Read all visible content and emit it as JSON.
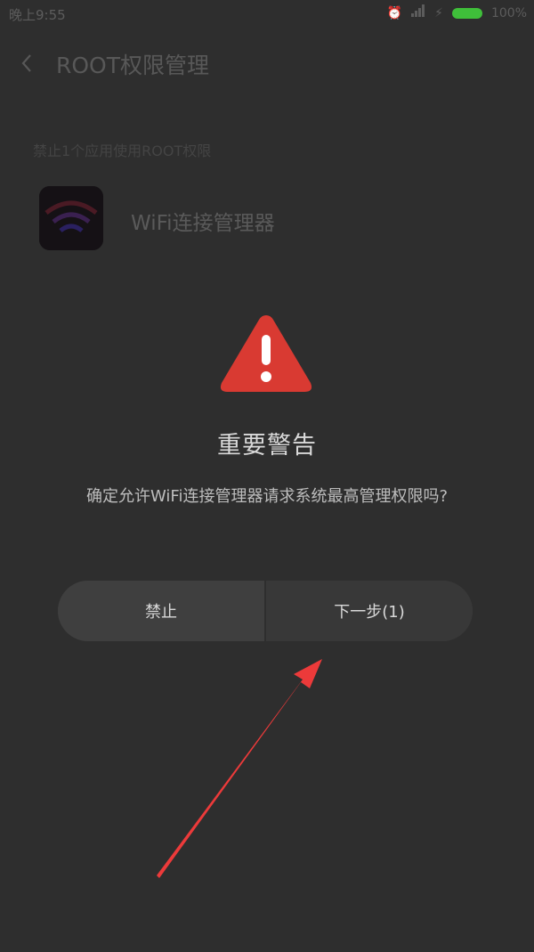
{
  "status_bar": {
    "time": "晚上9:55",
    "battery_text": "100%",
    "icons": [
      "alarm-icon",
      "signal-icon",
      "charging-icon",
      "battery-icon"
    ]
  },
  "header": {
    "title": "ROOT权限管理",
    "back_icon": "chevron-left-icon"
  },
  "content": {
    "section_caption": "禁止1个应用使用ROOT权限",
    "app": {
      "name": "WiFi连接管理器",
      "icon": "app-icon"
    }
  },
  "dialog": {
    "icon": "warning-triangle-icon",
    "title": "重要警告",
    "message": "确定允许WiFi连接管理器请求系统最高管理权限吗?",
    "buttons": {
      "forbid": "禁止",
      "next": "下一步(1)"
    }
  },
  "annotation": {
    "arrow_icon": "red-arrow-icon",
    "color": "#ec3a3a"
  },
  "colors": {
    "warning_red": "#d93a32",
    "battery_green": "#3fbf3a",
    "dialog_bg": "#2e2e2e"
  }
}
